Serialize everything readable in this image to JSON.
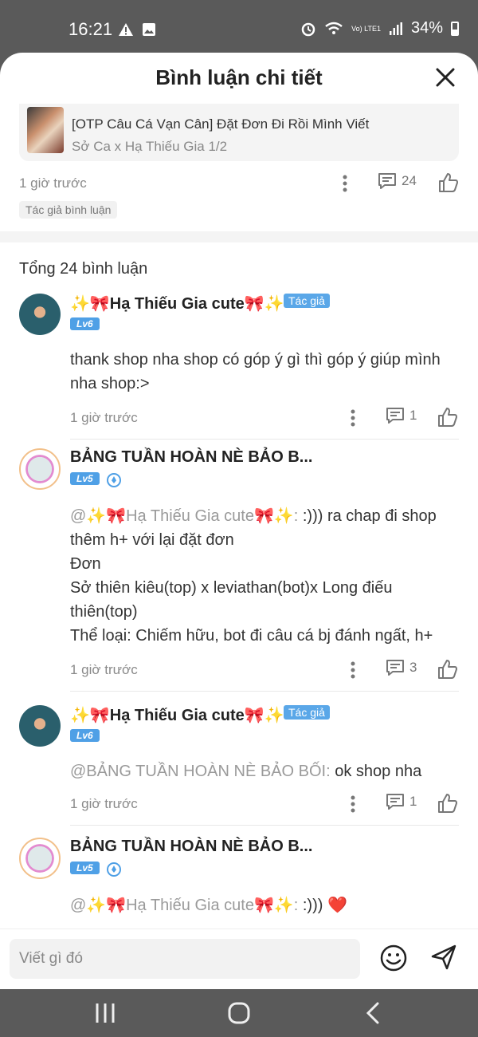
{
  "status": {
    "time": "16:21",
    "battery": "34%",
    "network": "Vo) LTE1"
  },
  "header": {
    "title": "Bình luận chi tiết"
  },
  "story": {
    "title": "[OTP Câu Cá Vạn Cân] Đặt Đơn Đi Rồi Mình Viết",
    "subtitle": "Sở Ca x Hạ Thiếu Gia 1/2"
  },
  "parent_comment": {
    "time": "1 giờ trước",
    "reply_count": "24",
    "author_tag": "Tác giả bình luận"
  },
  "total_label": "Tổng 24 bình luận",
  "comments": [
    {
      "name": "✨🎀Hạ Thiếu Gia cute🎀✨",
      "author_badge": "Tác giả",
      "level": "Lv6",
      "body": "thank shop nha shop có góp ý gì thì góp ý giúp mình nha shop:>",
      "time": "1 giờ trước",
      "replies": "1"
    },
    {
      "name": "BẢNG TUẦN HOÀN NÈ BẢO B...",
      "level": "Lv5",
      "mention": "@✨🎀Hạ Thiếu Gia cute🎀✨:",
      "body_line1": " :))) ra chap đi shop",
      "body_line2": "thêm h+ với lại đặt đơn",
      "body_line3": "Đơn",
      "body_line4": "Sở thiên kiêu(top) x leviathan(bot)x Long điếu thiên(top)",
      "body_line5": "Thể loại: Chiếm hữu, bot đi câu cá bj đánh ngất, h+",
      "time": "1 giờ trước",
      "replies": "3"
    },
    {
      "name": "✨🎀Hạ Thiếu Gia cute🎀✨",
      "author_badge": "Tác giả",
      "level": "Lv6",
      "mention": "@BẢNG TUẦN HOÀN NÈ BẢO BỐI:",
      "body": " ok shop nha",
      "time": "1 giờ trước",
      "replies": "1"
    },
    {
      "name": "BẢNG TUẦN HOÀN NÈ BẢO B...",
      "level": "Lv5",
      "mention": "@✨🎀Hạ Thiếu Gia cute🎀✨:",
      "body": " :))) ",
      "heart": "❤️"
    }
  ],
  "input": {
    "placeholder": "Viết gì đó"
  },
  "colors": {
    "accent": "#5aa7e8",
    "level_badge": "#4fa0e6",
    "heart": "#e53935"
  },
  "icons": [
    "close-icon",
    "more-icon",
    "comment-icon",
    "like-icon",
    "emoji-icon",
    "send-icon",
    "recent-apps-icon",
    "home-icon",
    "back-icon"
  ]
}
